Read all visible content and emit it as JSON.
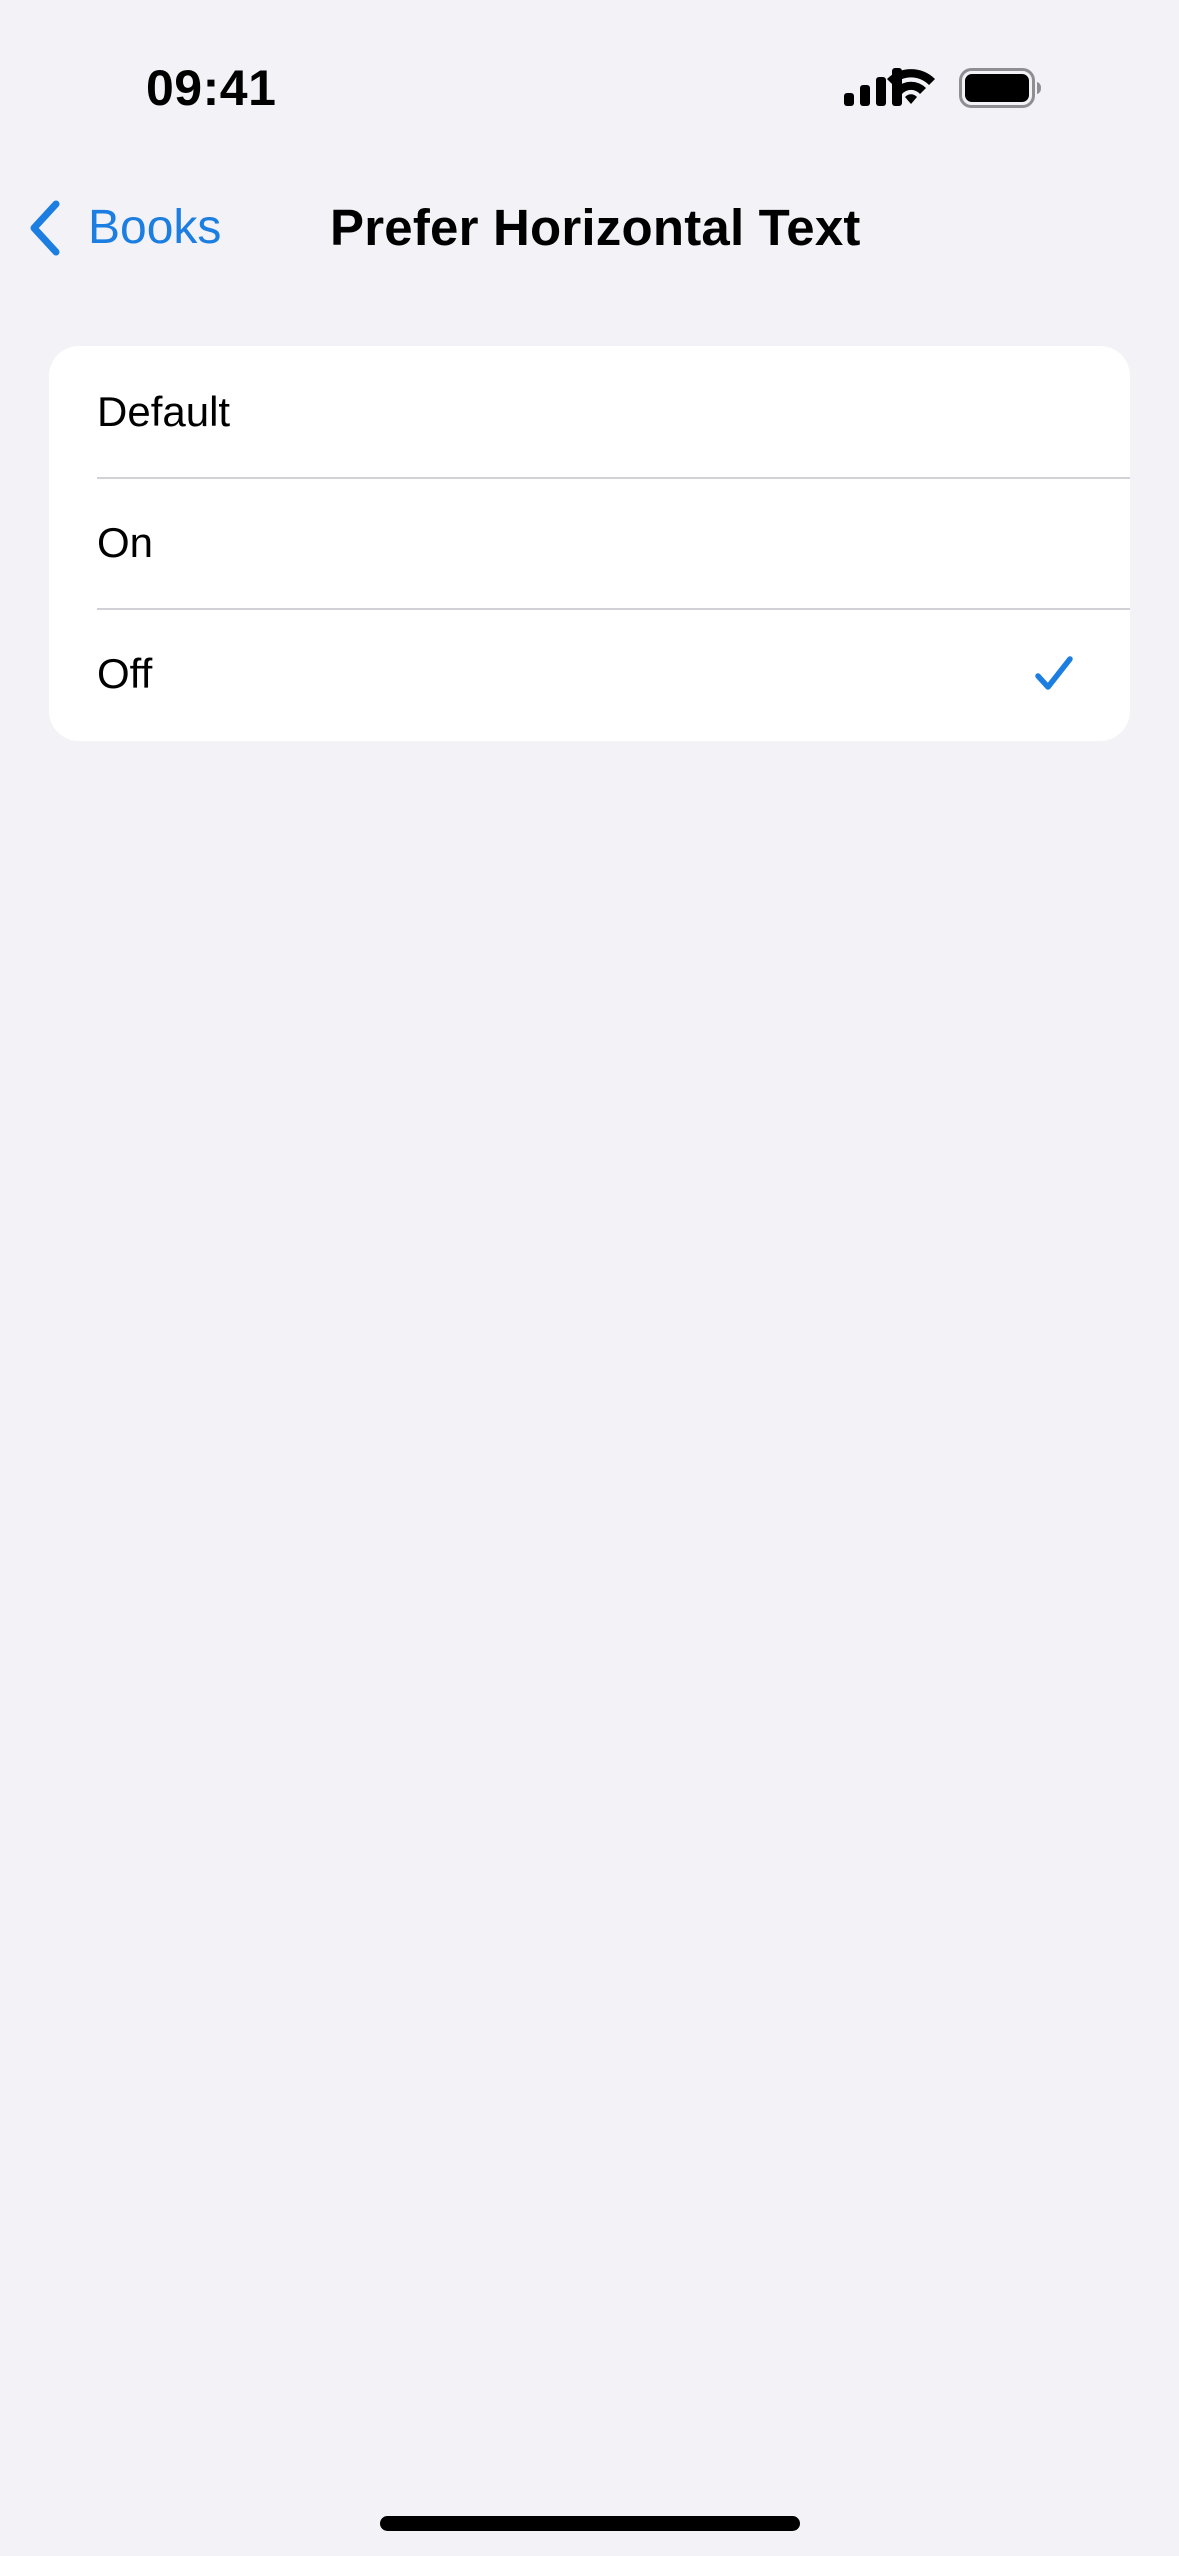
{
  "status_bar": {
    "time": "09:41",
    "icons": [
      "cellular-signal-icon",
      "wifi-icon",
      "battery-icon"
    ]
  },
  "nav": {
    "back_label": "Books",
    "back_icon": "chevron-left-icon",
    "title": "Prefer Horizontal Text"
  },
  "options": [
    {
      "label": "Default",
      "selected": false
    },
    {
      "label": "On",
      "selected": false
    },
    {
      "label": "Off",
      "selected": true
    }
  ],
  "colors": {
    "accent": "#1b7ee0",
    "background": "#f2f2f7",
    "card": "#ffffff",
    "separator": "#d1d1d6"
  }
}
